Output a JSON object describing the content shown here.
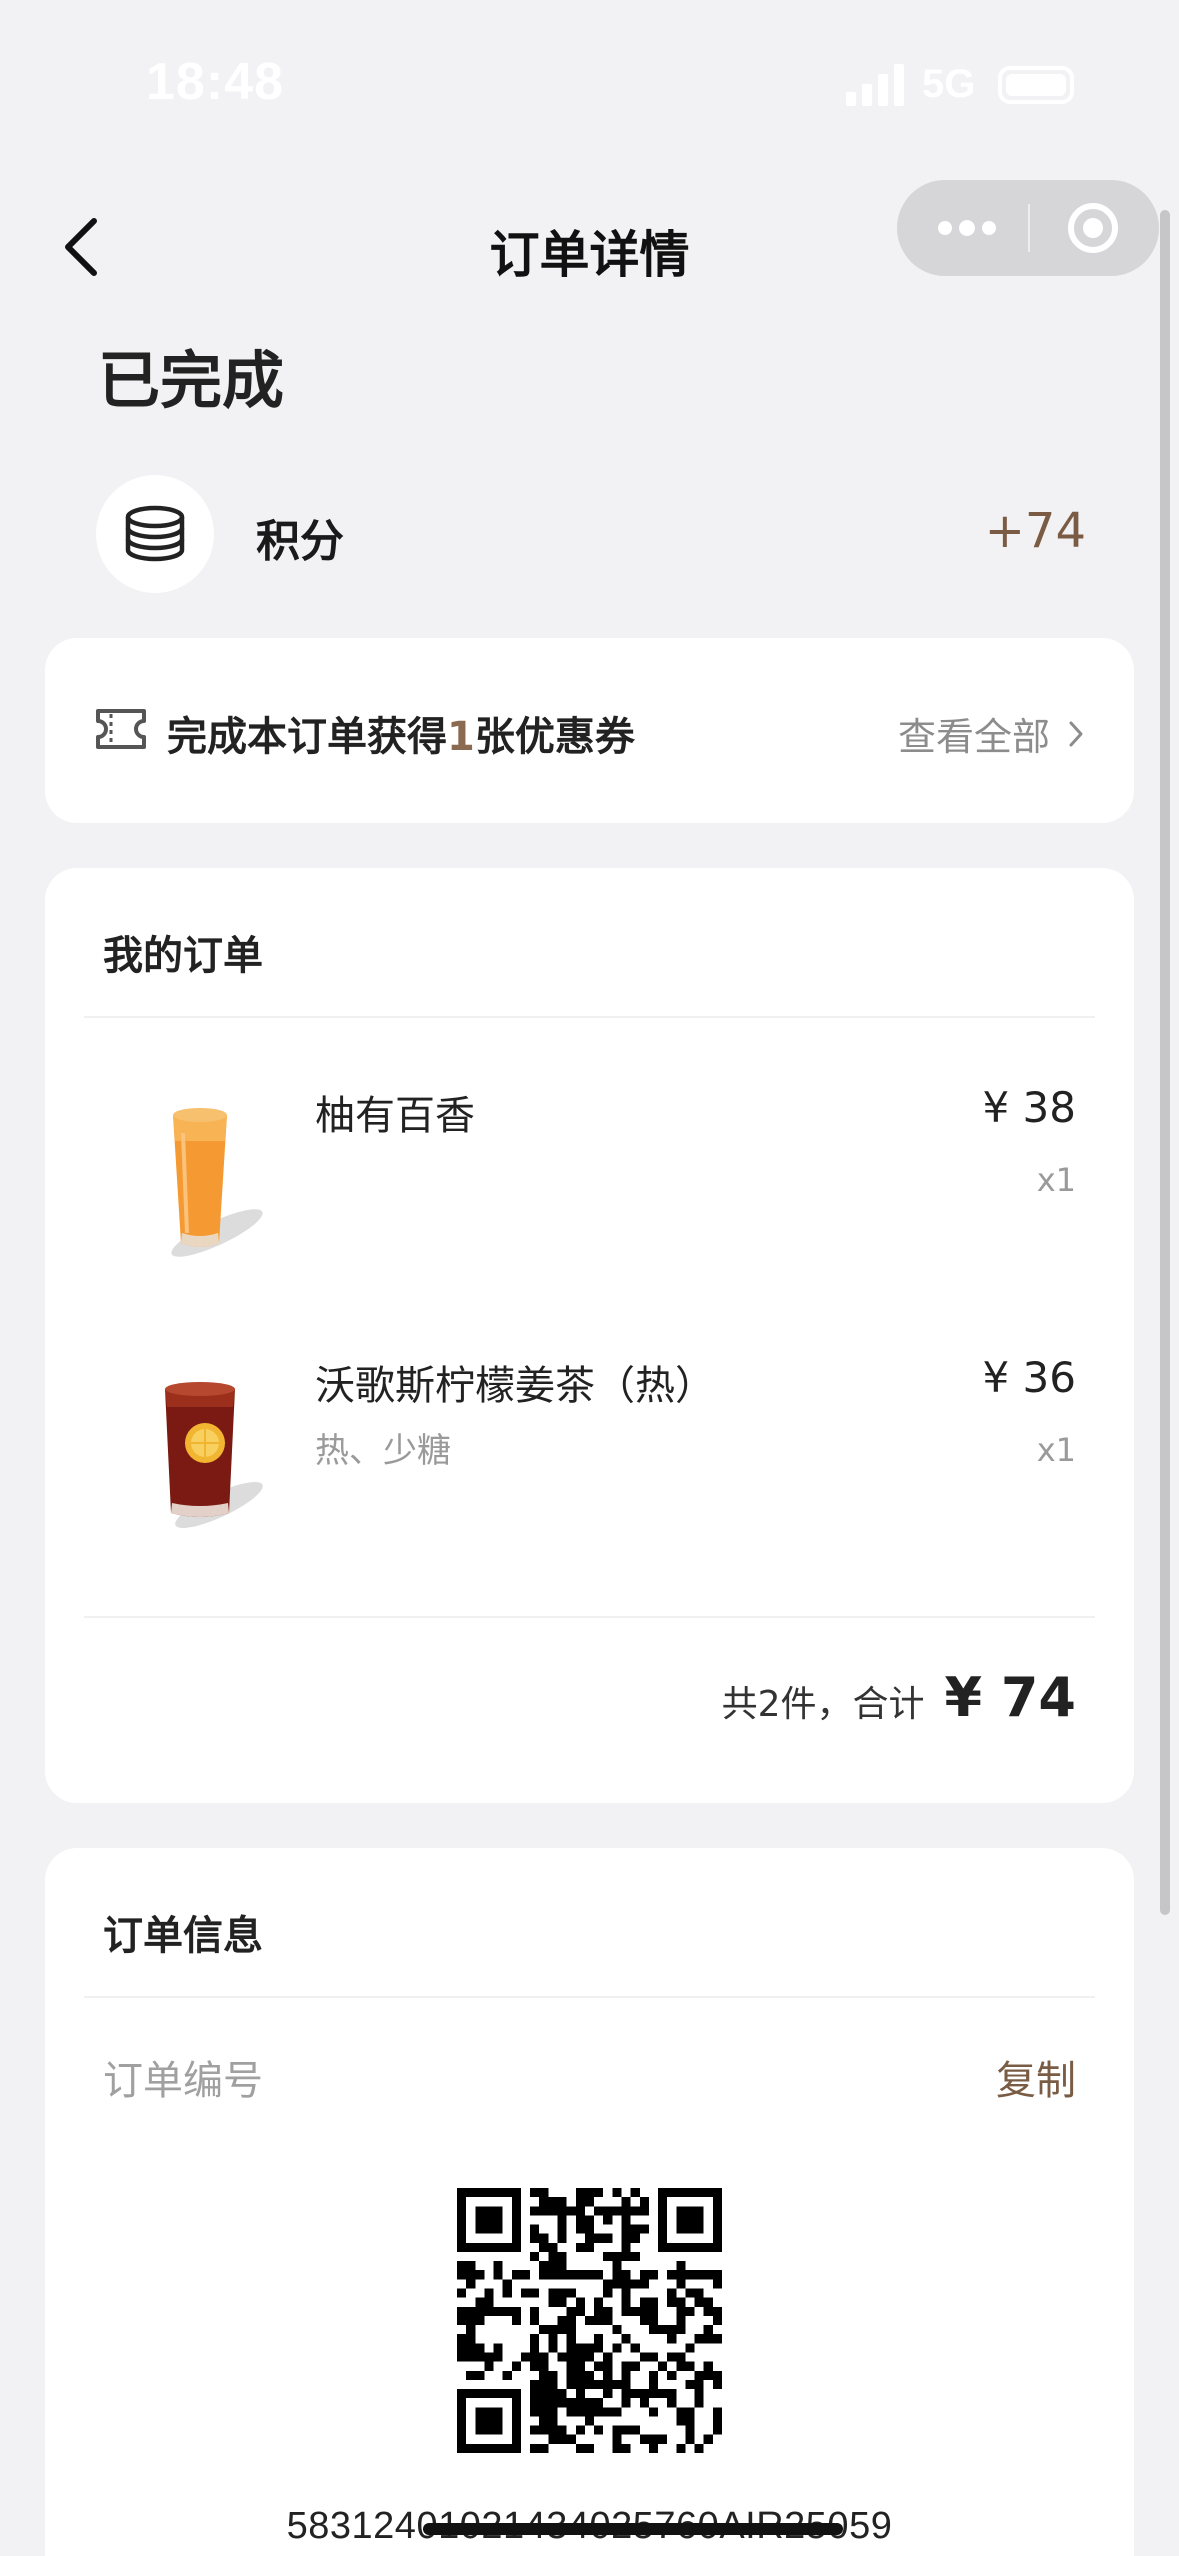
{
  "status_bar": {
    "time": "18:48",
    "network": "5G"
  },
  "nav": {
    "title": "订单详情"
  },
  "order_status": "已完成",
  "points": {
    "label": "积分",
    "value": "+74"
  },
  "coupon": {
    "text_prefix": "完成本订单获得",
    "count": "1",
    "text_suffix": "张优惠券",
    "view_all": "查看全部"
  },
  "my_order": {
    "title": "我的订单",
    "items": [
      {
        "name": "柚有百香",
        "spec": "",
        "price": "¥ 38",
        "qty": "x1"
      },
      {
        "name": "沃歌斯柠檬姜茶（热）",
        "spec": "热、少糖",
        "price": "¥ 36",
        "qty": "x1"
      }
    ],
    "total_label": "共2件，合计",
    "total_value": "¥ 74"
  },
  "order_info": {
    "title": "订单信息",
    "number_label": "订单编号",
    "copy_label": "复制",
    "number": "58312401021434025760AIR25059"
  },
  "colors": {
    "accent": "#7a5c45",
    "background": "#f2f1f3"
  }
}
